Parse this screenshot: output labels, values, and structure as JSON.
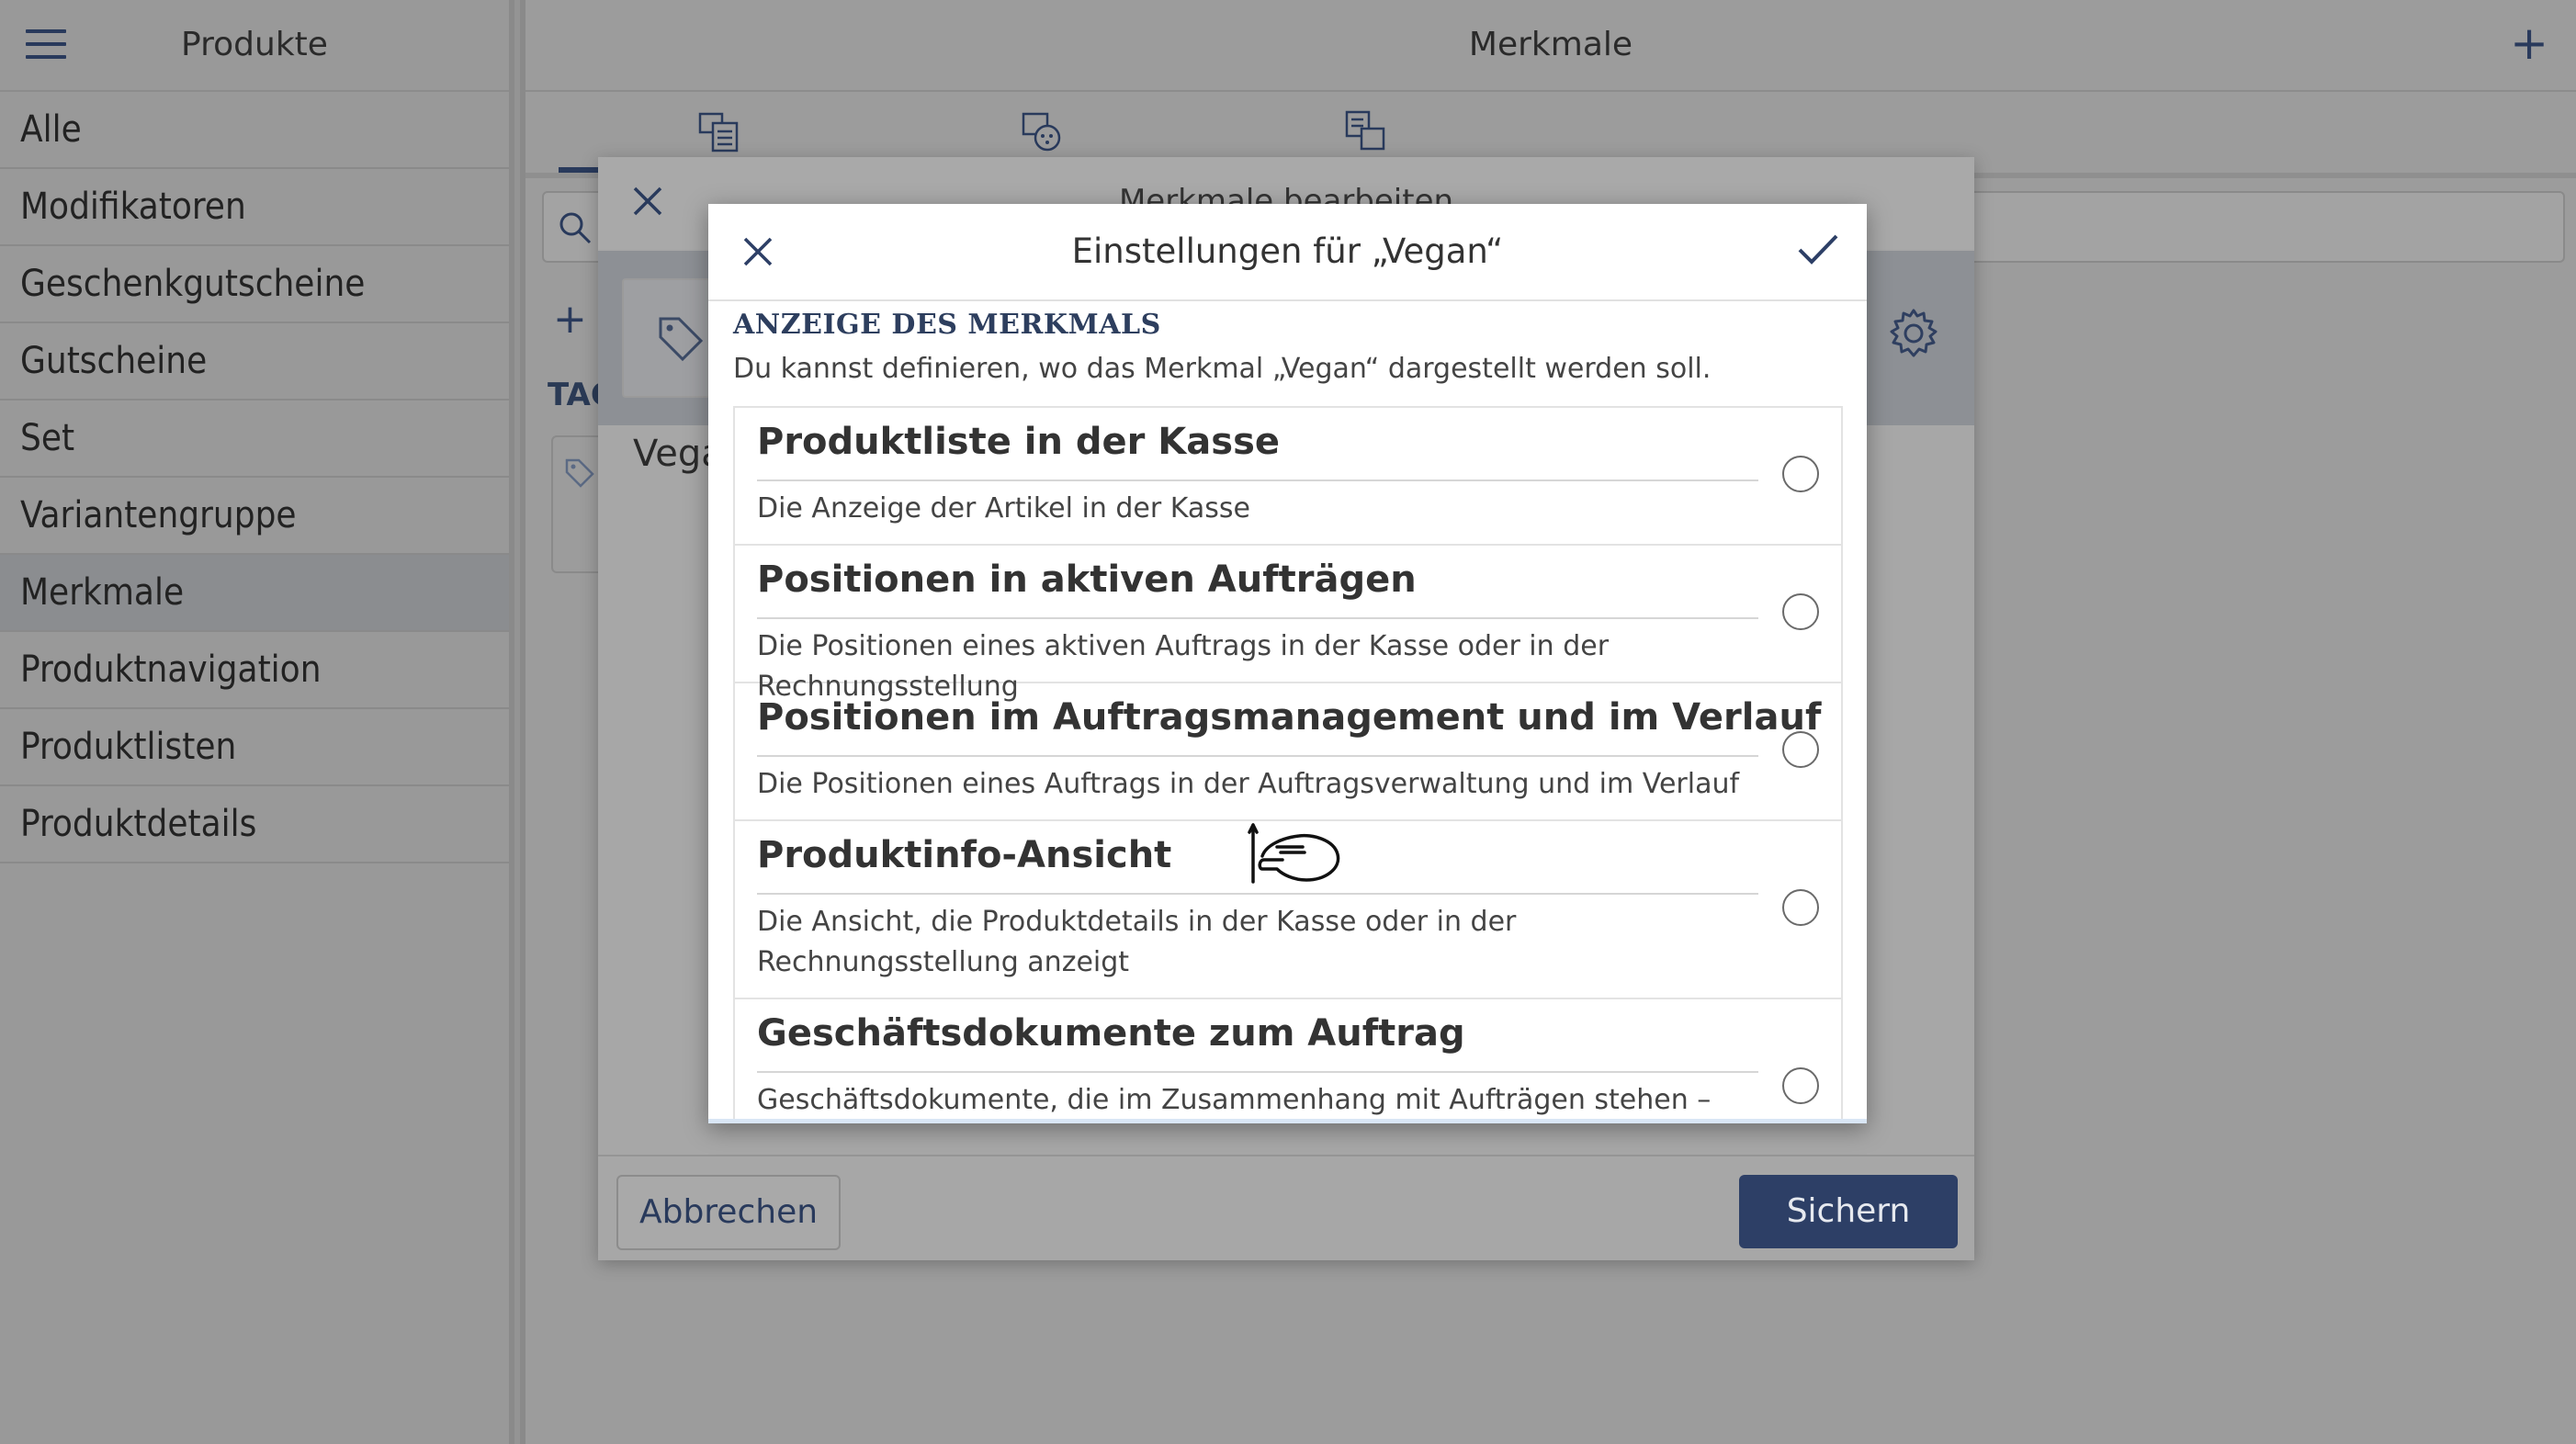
{
  "sidebar": {
    "title": "Produkte",
    "items": [
      {
        "label": "Alle"
      },
      {
        "label": "Modifikatoren"
      },
      {
        "label": "Geschenkgutscheine"
      },
      {
        "label": "Gutscheine"
      },
      {
        "label": "Set"
      },
      {
        "label": "Variantengruppe"
      },
      {
        "label": "Merkmale",
        "active": true
      },
      {
        "label": "Produktnavigation"
      },
      {
        "label": "Produktlisten"
      },
      {
        "label": "Produktdetails"
      }
    ]
  },
  "main": {
    "title": "Merkmale",
    "add_icon": "plus-icon",
    "tag_section_partial": "TAG"
  },
  "edit_dialog": {
    "title": "Merkmale bearbeiten",
    "item_partial": "Vega",
    "cancel_label": "Abbrechen",
    "save_label": "Sichern"
  },
  "settings_dialog": {
    "title": "Einstellungen für „Vegan“",
    "section_label": "ANZEIGE DES MERKMALS",
    "section_desc": "Du kannst definieren, wo das Merkmal „Vegan“ dargestellt werden soll.",
    "options": [
      {
        "title": "Produktliste in der Kasse",
        "desc": "Die Anzeige der Artikel in der Kasse",
        "checked": false
      },
      {
        "title": "Positionen in aktiven Aufträgen",
        "desc": "Die Positionen eines aktiven Auftrags in der Kasse oder in der Rechnungsstellung",
        "checked": false
      },
      {
        "title": "Positionen im Auftragsmanagement und im Verlauf",
        "desc": "Die Positionen eines Auftrags in der Auftragsverwaltung und im Verlauf",
        "checked": false
      },
      {
        "title": "Produktinfo-Ansicht",
        "desc": "Die Ansicht, die Produktdetails in der Kasse oder in der Rechnungsstellung anzeigt",
        "checked": false
      },
      {
        "title": "Geschäftsdokumente zum Auftrag",
        "desc": "Geschäftsdokumente, die im Zusammenhang mit Aufträgen stehen – z.B.",
        "checked": false
      }
    ]
  },
  "colors": {
    "accent": "#2d3f66",
    "overlay": "#9b9b9b",
    "dialog_bg": "#ffffff"
  }
}
